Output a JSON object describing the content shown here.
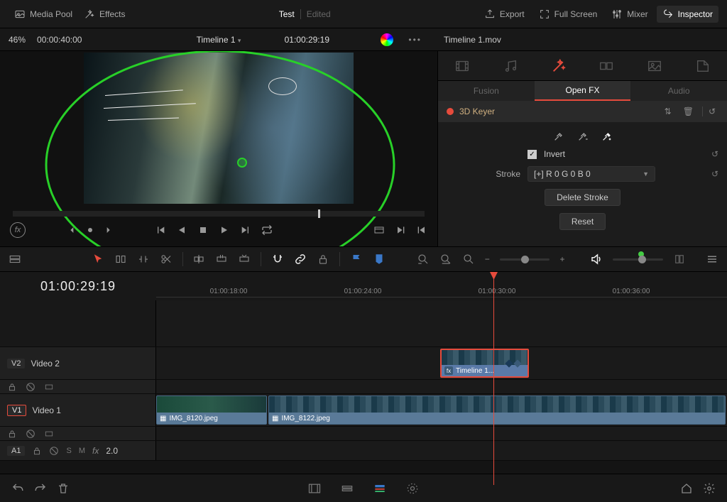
{
  "topbar": {
    "media_pool": "Media Pool",
    "effects": "Effects",
    "title": "Test",
    "edited": "Edited",
    "export": "Export",
    "fullscreen": "Full Screen",
    "mixer": "Mixer",
    "inspector": "Inspector"
  },
  "viewer": {
    "zoom": "46%",
    "duration": "00:00:40:00",
    "timeline_name": "Timeline 1",
    "timecode": "01:00:29:19",
    "clip_name": "Timeline 1.mov"
  },
  "inspector": {
    "subtabs": {
      "fusion": "Fusion",
      "openfx": "Open FX",
      "audio": "Audio"
    },
    "effect_name": "3D Keyer",
    "invert_label": "Invert",
    "stroke_label": "Stroke",
    "stroke_value": "[+]  R 0  G 0  B 0",
    "delete_stroke": "Delete Stroke",
    "reset": "Reset"
  },
  "timeline": {
    "current_tc": "01:00:29:19",
    "ticks": [
      "01:00:18:00",
      "01:00:24:00",
      "01:00:30:00",
      "01:00:36:00"
    ],
    "tracks": {
      "v2": {
        "tag": "V2",
        "name": "Video 2"
      },
      "v1": {
        "tag": "V1",
        "name": "Video 1"
      },
      "a1": {
        "tag": "A1",
        "fx": "fx",
        "vol": "2.0"
      }
    },
    "clips": {
      "nested": "Timeline 1...",
      "img1": "IMG_8120.jpeg",
      "img2": "IMG_8122.jpeg"
    }
  }
}
